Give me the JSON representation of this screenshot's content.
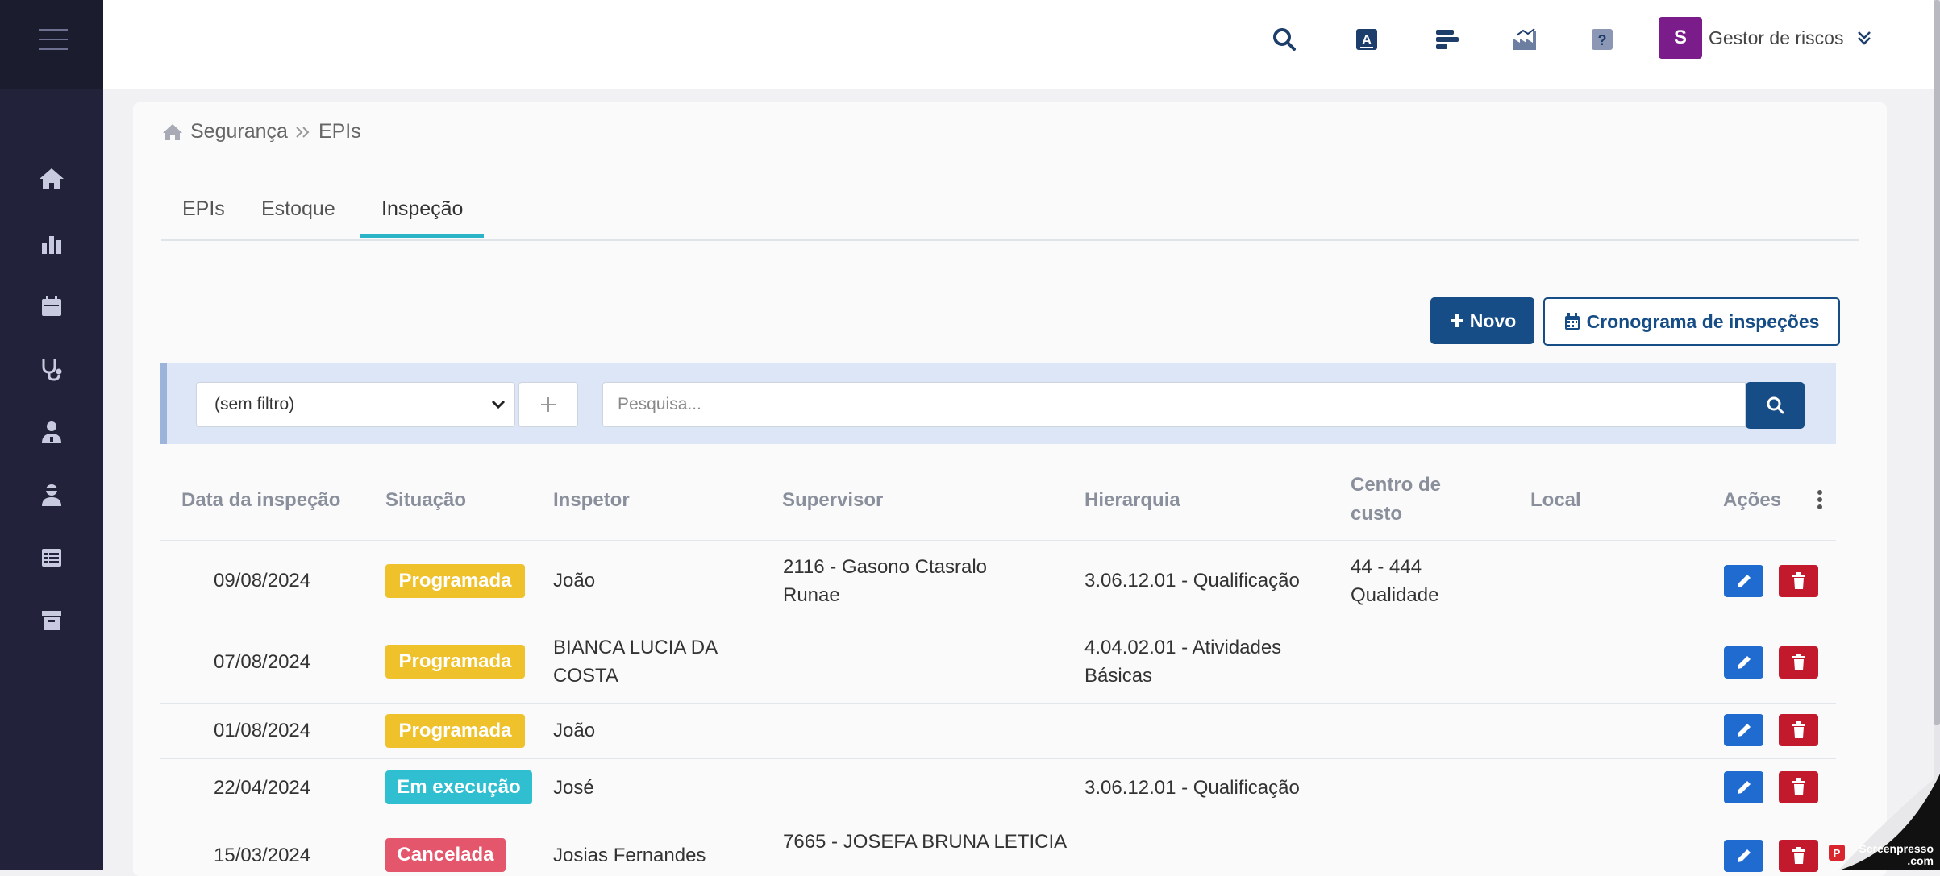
{
  "user": {
    "initial": "S",
    "name": "Gestor de riscos"
  },
  "breadcrumb": {
    "section": "Segurança",
    "page": "EPIs"
  },
  "tabs": [
    {
      "label": "EPIs"
    },
    {
      "label": "Estoque"
    },
    {
      "label": "Inspeção"
    }
  ],
  "actions": {
    "new_label": "Novo",
    "schedule_label": "Cronograma de inspeções"
  },
  "filter": {
    "selected": "(sem filtro)",
    "search_placeholder": "Pesquisa..."
  },
  "table": {
    "headers": {
      "date": "Data da inspeção",
      "status": "Situação",
      "inspector": "Inspetor",
      "supervisor": "Supervisor",
      "hierarchy": "Hierarquia",
      "cost_center_1": "Centro de",
      "cost_center_2": "custo",
      "location": "Local",
      "actions": "Ações"
    },
    "rows": [
      {
        "date": "09/08/2024",
        "status": "Programada",
        "inspector_1": "João",
        "inspector_2": "",
        "supervisor_1": "2116 - Gasono Ctasralo",
        "supervisor_2": "Runae",
        "hierarchy_1": "3.06.12.01 - Qualificação",
        "hierarchy_2": "",
        "cost_1": "44 - 444",
        "cost_2": "Qualidade",
        "location": ""
      },
      {
        "date": "07/08/2024",
        "status": "Programada",
        "inspector_1": "BIANCA LUCIA DA",
        "inspector_2": "COSTA",
        "supervisor_1": "",
        "supervisor_2": "",
        "hierarchy_1": "4.04.02.01 - Atividades",
        "hierarchy_2": "Básicas",
        "cost_1": "",
        "cost_2": "",
        "location": ""
      },
      {
        "date": "01/08/2024",
        "status": "Programada",
        "inspector_1": "João",
        "inspector_2": "",
        "supervisor_1": "",
        "supervisor_2": "",
        "hierarchy_1": "",
        "hierarchy_2": "",
        "cost_1": "",
        "cost_2": "",
        "location": ""
      },
      {
        "date": "22/04/2024",
        "status": "Em execução",
        "inspector_1": "José",
        "inspector_2": "",
        "supervisor_1": "",
        "supervisor_2": "",
        "hierarchy_1": "3.06.12.01 - Qualificação",
        "hierarchy_2": "",
        "cost_1": "",
        "cost_2": "",
        "location": ""
      },
      {
        "date": "15/03/2024",
        "status": "Cancelada",
        "inspector_1": "Josias Fernandes",
        "inspector_2": "",
        "supervisor_1": "7665 - JOSEFA BRUNA LETICIA",
        "supervisor_2": "",
        "hierarchy_1": "",
        "hierarchy_2": "",
        "cost_1": "",
        "cost_2": "",
        "location": ""
      }
    ]
  },
  "watermark": {
    "line1": "Screenpresso",
    "line2": ".com"
  },
  "icons": [
    "menu-icon",
    "home-icon",
    "bar-chart-icon",
    "calendar-icon",
    "stethoscope-icon",
    "doctor-icon",
    "user-icon",
    "list-icon",
    "archive-icon",
    "search-icon",
    "font-icon",
    "bars-icon",
    "industry-icon",
    "help-icon",
    "chevron-down-icon",
    "pencil-icon",
    "trash-icon",
    "plus-icon"
  ],
  "colors": {
    "sidebar": "#22233a",
    "primary": "#164d86",
    "tab_accent": "#2bb4c8",
    "programada": "#efc12b",
    "em_execucao": "#2fbfd0",
    "cancelada": "#e4566b",
    "edit": "#1f6bd0",
    "delete": "#c21a2c"
  }
}
